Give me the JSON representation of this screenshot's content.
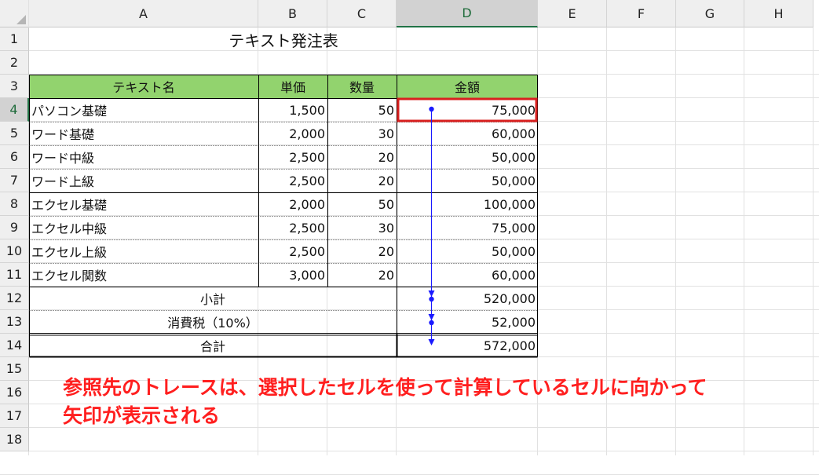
{
  "columns": [
    "A",
    "B",
    "C",
    "D",
    "E",
    "F",
    "G",
    "H"
  ],
  "rows": [
    "1",
    "2",
    "3",
    "4",
    "5",
    "6",
    "7",
    "8",
    "9",
    "10",
    "11",
    "12",
    "13",
    "14",
    "15",
    "16",
    "17",
    "18"
  ],
  "title": "テキスト発注表",
  "header": {
    "name": "テキスト名",
    "price": "単価",
    "qty": "数量",
    "amount": "金額"
  },
  "items": [
    {
      "name": "パソコン基礎",
      "price": "1,500",
      "qty": "50",
      "amount": "75,000"
    },
    {
      "name": "ワード基礎",
      "price": "2,000",
      "qty": "30",
      "amount": "60,000"
    },
    {
      "name": "ワード中級",
      "price": "2,500",
      "qty": "20",
      "amount": "50,000"
    },
    {
      "name": "ワード上級",
      "price": "2,500",
      "qty": "20",
      "amount": "50,000"
    },
    {
      "name": "エクセル基礎",
      "price": "2,000",
      "qty": "50",
      "amount": "100,000"
    },
    {
      "name": "エクセル中級",
      "price": "2,500",
      "qty": "30",
      "amount": "75,000"
    },
    {
      "name": "エクセル上級",
      "price": "2,500",
      "qty": "20",
      "amount": "50,000"
    },
    {
      "name": "エクセル関数",
      "price": "3,000",
      "qty": "20",
      "amount": "60,000"
    }
  ],
  "subtotal": {
    "label": "小計",
    "amount": "520,000"
  },
  "tax": {
    "label": "消費税（10%）",
    "amount": "52,000"
  },
  "total": {
    "label": "合計",
    "amount": "572,000"
  },
  "caption": {
    "line1": "参照先のトレースは、選択したセルを使って計算しているセルに向かって",
    "line2": "矢印が表示される"
  },
  "colors": {
    "header_fill": "#92d36e",
    "selected_border": "#d9201f",
    "trace_arrow": "#1a1aff",
    "caption_text": "#ff1f1f"
  }
}
